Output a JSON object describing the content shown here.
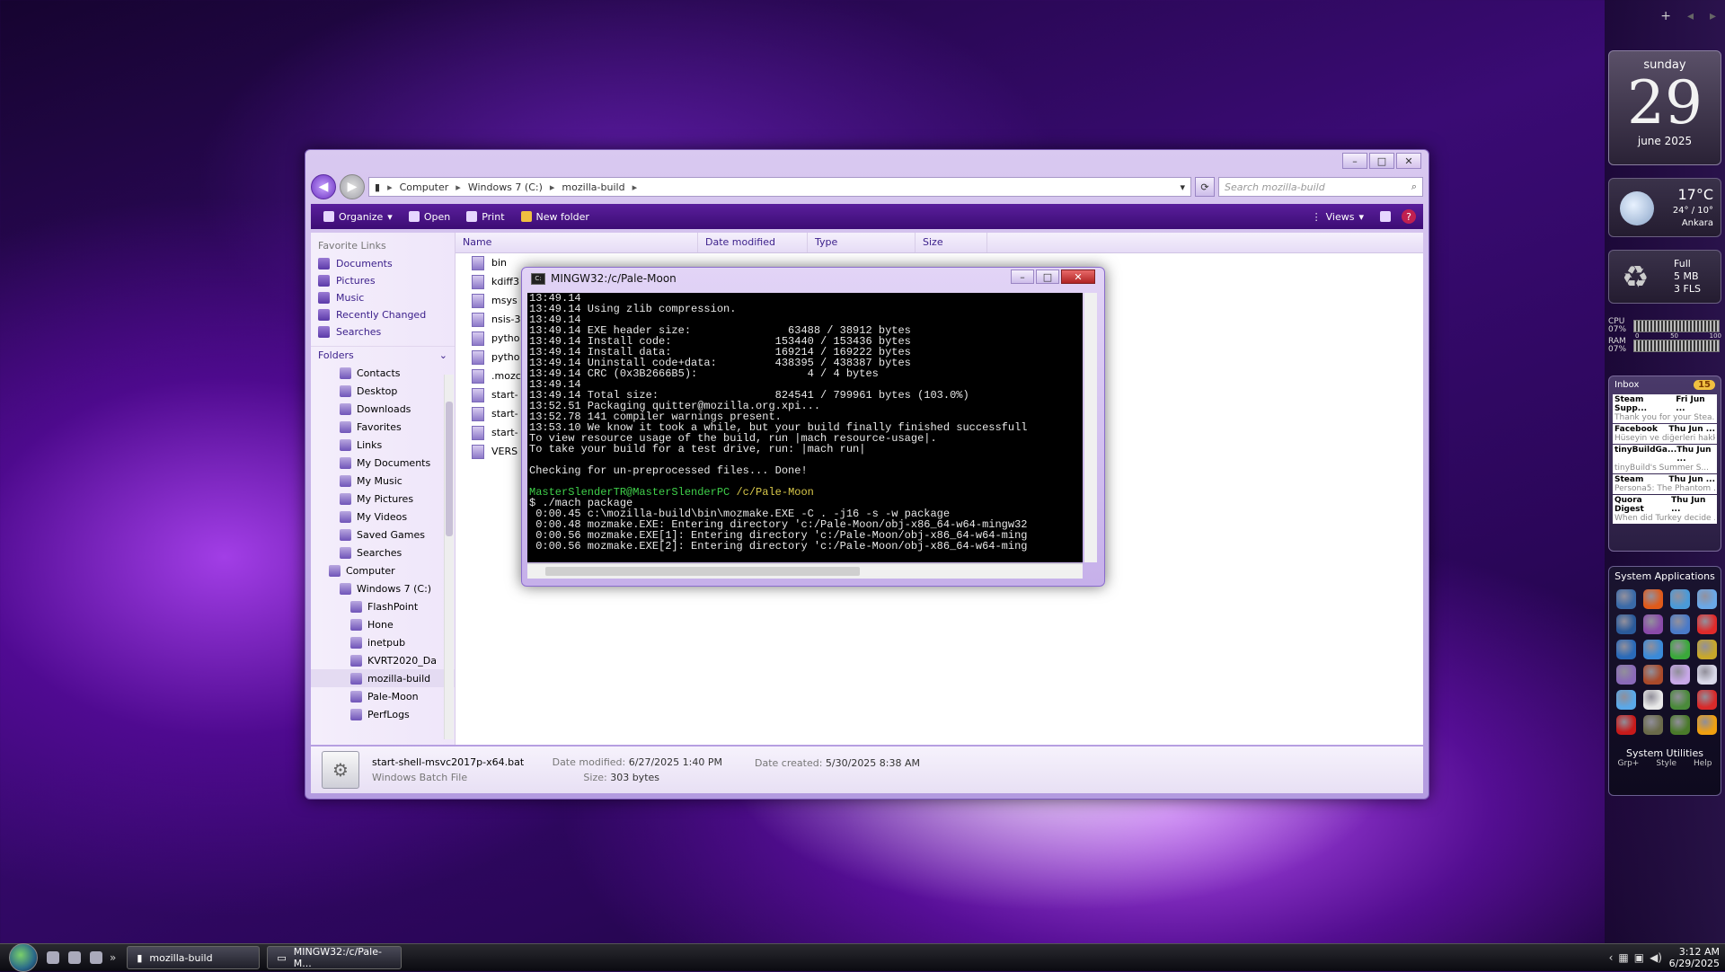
{
  "explorer": {
    "breadcrumb": [
      "Computer",
      "Windows 7 (C:)",
      "mozilla-build"
    ],
    "search_placeholder": "Search mozilla-build",
    "toolbar": {
      "organize": "Organize",
      "open": "Open",
      "print": "Print",
      "new_folder": "New folder",
      "views": "Views"
    },
    "nav": {
      "favorite_links_header": "Favorite Links",
      "favorites": [
        "Documents",
        "Pictures",
        "Music",
        "Recently Changed",
        "Searches"
      ],
      "folders_header": "Folders",
      "tree": [
        {
          "label": "Contacts",
          "indent": 2
        },
        {
          "label": "Desktop",
          "indent": 2
        },
        {
          "label": "Downloads",
          "indent": 2
        },
        {
          "label": "Favorites",
          "indent": 2
        },
        {
          "label": "Links",
          "indent": 2
        },
        {
          "label": "My Documents",
          "indent": 2
        },
        {
          "label": "My Music",
          "indent": 2
        },
        {
          "label": "My Pictures",
          "indent": 2
        },
        {
          "label": "My Videos",
          "indent": 2
        },
        {
          "label": "Saved Games",
          "indent": 2
        },
        {
          "label": "Searches",
          "indent": 2
        },
        {
          "label": "Computer",
          "indent": 1
        },
        {
          "label": "Windows 7 (C:)",
          "indent": 2
        },
        {
          "label": "FlashPoint",
          "indent": 3
        },
        {
          "label": "Hone",
          "indent": 3
        },
        {
          "label": "inetpub",
          "indent": 3
        },
        {
          "label": "KVRT2020_Da",
          "indent": 3
        },
        {
          "label": "mozilla-build",
          "indent": 3,
          "selected": true
        },
        {
          "label": "Pale-Moon",
          "indent": 3
        },
        {
          "label": "PerfLogs",
          "indent": 3
        }
      ]
    },
    "columns": [
      "Name",
      "Date modified",
      "Type",
      "Size"
    ],
    "files": [
      "bin",
      "kdiff3",
      "msys",
      "nsis-3",
      "pytho",
      "pytho",
      ".mozc",
      "start-",
      "start-",
      "start-",
      "VERS"
    ],
    "details": {
      "filename": "start-shell-msvc2017p-x64.bat",
      "type": "Windows Batch File",
      "date_modified_label": "Date modified:",
      "date_modified": "6/27/2025 1:40 PM",
      "date_created_label": "Date created:",
      "date_created": "5/30/2025 8:38 AM",
      "size_label": "Size:",
      "size": "303 bytes"
    }
  },
  "terminal": {
    "title": "MINGW32:/c/Pale-Moon",
    "lines": [
      {
        "t": "13:49.14"
      },
      {
        "t": "13:49.14 Using zlib compression."
      },
      {
        "t": "13:49.14"
      },
      {
        "t": "13:49.14 EXE header size:               63488 / 38912 bytes"
      },
      {
        "t": "13:49.14 Install code:                153440 / 153436 bytes"
      },
      {
        "t": "13:49.14 Install data:                169214 / 169222 bytes"
      },
      {
        "t": "13:49.14 Uninstall code+data:         438395 / 438387 bytes"
      },
      {
        "t": "13:49.14 CRC (0x3B2666B5):                 4 / 4 bytes"
      },
      {
        "t": "13:49.14"
      },
      {
        "t": "13:49.14 Total size:                  824541 / 799961 bytes (103.0%)"
      },
      {
        "t": "13:52.51 Packaging quitter@mozilla.org.xpi..."
      },
      {
        "t": "13:52.78 141 compiler warnings present."
      },
      {
        "t": "13:53.10 We know it took a while, but your build finally finished successfull"
      },
      {
        "t": "To view resource usage of the build, run |mach resource-usage|."
      },
      {
        "t": "To take your build for a test drive, run: |mach run|"
      },
      {
        "t": ""
      },
      {
        "t": "Checking for un-preprocessed files... Done!"
      },
      {
        "t": ""
      },
      {
        "t": "MasterSlenderTR@MasterSlenderPC /c/Pale-Moon",
        "prompt": true
      },
      {
        "t": "$ ./mach package"
      },
      {
        "t": " 0:00.45 c:\\mozilla-build\\bin\\mozmake.EXE -C . -j16 -s -w package"
      },
      {
        "t": " 0:00.48 mozmake.EXE: Entering directory 'c:/Pale-Moon/obj-x86_64-w64-mingw32"
      },
      {
        "t": " 0:00.56 mozmake.EXE[1]: Entering directory 'c:/Pale-Moon/obj-x86_64-w64-ming"
      },
      {
        "t": " 0:00.56 mozmake.EXE[2]: Entering directory 'c:/Pale-Moon/obj-x86_64-w64-ming"
      }
    ],
    "prompt_user": "MasterSlenderTR@MasterSlenderPC",
    "prompt_path": "/c/Pale-Moon"
  },
  "gadgets": {
    "calendar": {
      "weekday": "sunday",
      "day": "29",
      "month_year": "june 2025"
    },
    "weather": {
      "temp": "17°C",
      "hilo": "24° / 10°",
      "city": "Ankara"
    },
    "recycle": {
      "state": "Full",
      "size": "5 MB",
      "files": "3 FLS"
    },
    "meter": {
      "cpu_label": "CPU",
      "cpu": "07%",
      "ram_label": "RAM",
      "ram": "07%",
      "scale": [
        "0",
        "50",
        "100"
      ]
    },
    "inbox": {
      "title": "Inbox",
      "count": "15",
      "mails": [
        {
          "from": "Steam Supp...",
          "date": "Fri Jun ...",
          "preview": "Thank you for your Stea..."
        },
        {
          "from": "Facebook",
          "date": "Thu Jun ...",
          "preview": "Hüseyin ve diğerleri hakkı..."
        },
        {
          "from": "tinyBuildGa...",
          "date": "Thu Jun ...",
          "preview": "tinyBuild's Summer S..."
        },
        {
          "from": "Steam",
          "date": "Thu Jun ...",
          "preview": "Persona5: The Phantom ..."
        },
        {
          "from": "Quora Digest",
          "date": "Thu Jun ...",
          "preview": "When did Turkey decide ..."
        }
      ]
    },
    "apps": {
      "title": "System Applications",
      "utilities": "System Utilities",
      "footer": [
        "Grp+",
        "Style",
        "Help"
      ],
      "colors": [
        "#3a6aa8",
        "#e05a1a",
        "#4a9ad8",
        "#6aa8e8",
        "#2a5a9a",
        "#8a4aaa",
        "#4a7ac8",
        "#e02a2a",
        "#2a6ab8",
        "#3a8ad8",
        "#3aa83a",
        "#c8a82a",
        "#8a6ab8",
        "#aa4a2a",
        "#c8a8e8",
        "#d8d8e8",
        "#5aa8e8",
        "#e8e8e8",
        "#4a8a3a",
        "#d82a2a",
        "#c81a1a",
        "#6a6a4a",
        "#4a7a2a",
        "#f0a010"
      ]
    }
  },
  "taskbar": {
    "items": [
      "mozilla-build",
      "MINGW32:/c/Pale-M..."
    ],
    "time": "3:12 AM",
    "date": "6/29/2025"
  }
}
